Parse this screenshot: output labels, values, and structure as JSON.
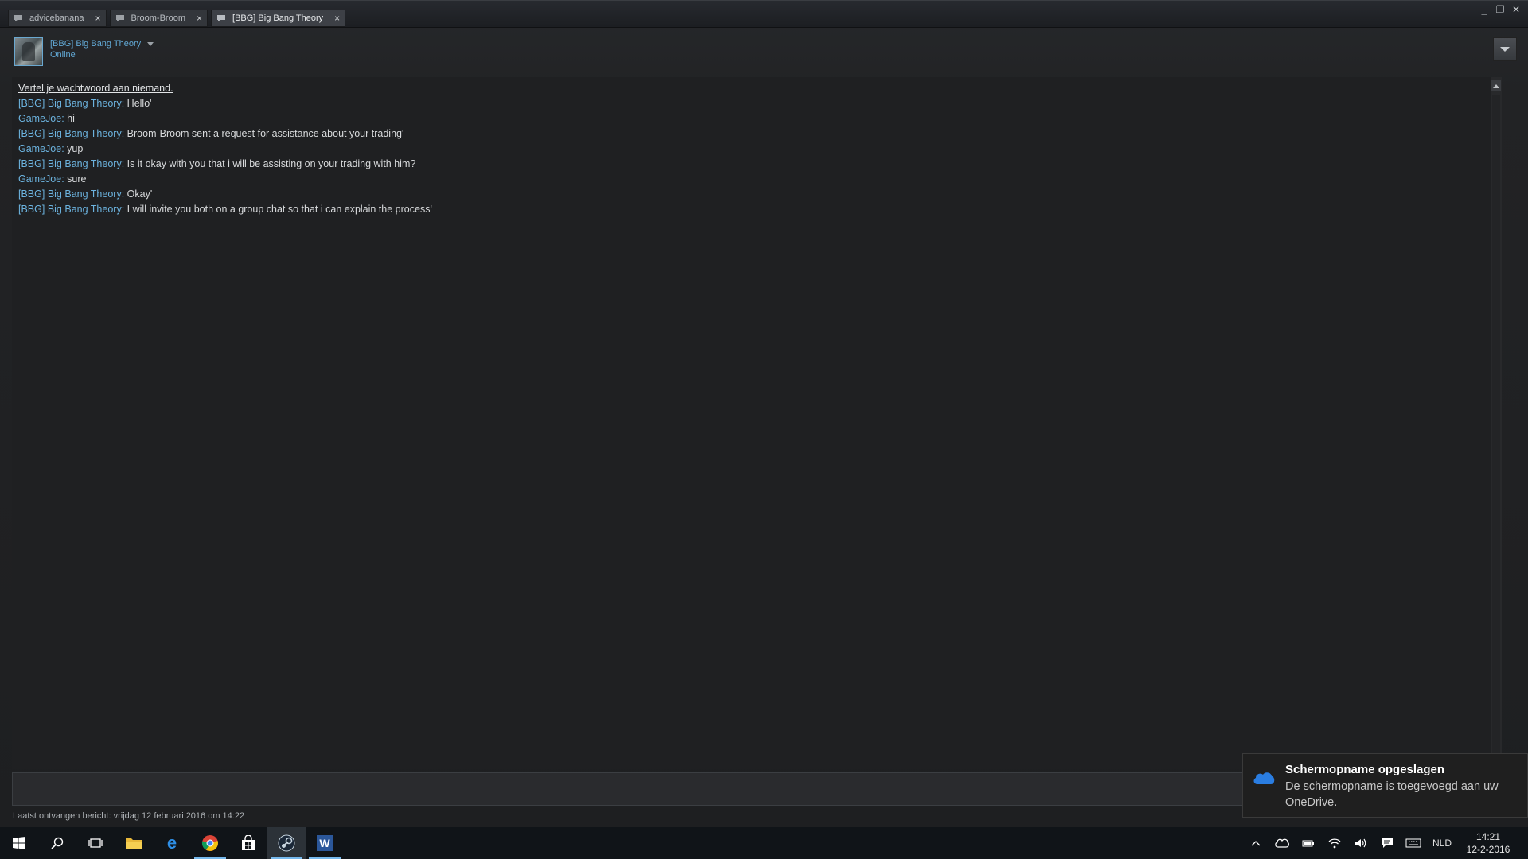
{
  "tabs": [
    {
      "label": "advicebanana",
      "close": "×"
    },
    {
      "label": "Broom-Broom",
      "close": "×"
    },
    {
      "label": "[BBG] Big Bang Theory",
      "close": "×",
      "active": true
    }
  ],
  "window_controls": {
    "minimize": "_",
    "restore": "❐",
    "close": "✕"
  },
  "header": {
    "persona_name": "[BBG] Big Bang Theory",
    "status": "Online"
  },
  "chat": {
    "warning": "Vertel je wachtwoord aan niemand.",
    "messages": [
      {
        "sender": "[BBG] Big Bang Theory",
        "text": " Hello'"
      },
      {
        "sender": "GameJoe",
        "text": " hi"
      },
      {
        "sender": "[BBG] Big Bang Theory",
        "text": " Broom-Broom sent a request for assistance about your trading'"
      },
      {
        "sender": "GameJoe",
        "text": " yup"
      },
      {
        "sender": "[BBG] Big Bang Theory",
        "text": " Is it okay with you that i will be assisting on your trading with him?"
      },
      {
        "sender": "GameJoe",
        "text": " sure"
      },
      {
        "sender": "[BBG] Big Bang Theory",
        "text": " Okay'"
      },
      {
        "sender": "[BBG] Big Bang Theory",
        "text": " I will invite you both on a group chat so that i can explain the process'"
      }
    ]
  },
  "footer": {
    "last_received": "Laatst ontvangen bericht: vrijdag 12 februari 2016 om 14:22"
  },
  "toast": {
    "title": "Schermopname opgeslagen",
    "body": "De schermopname is toegevoegd aan uw OneDrive."
  },
  "taskbar": {
    "apps": [
      "windows-start",
      "search",
      "task-view",
      "file-explorer",
      "edge",
      "chrome",
      "store",
      "steam",
      "word"
    ],
    "language": "NLD",
    "time": "14:21",
    "date": "12-2-2016"
  },
  "colors": {
    "accent": "#62a9d6",
    "background": "#1f2022",
    "taskbar": "#101418"
  }
}
